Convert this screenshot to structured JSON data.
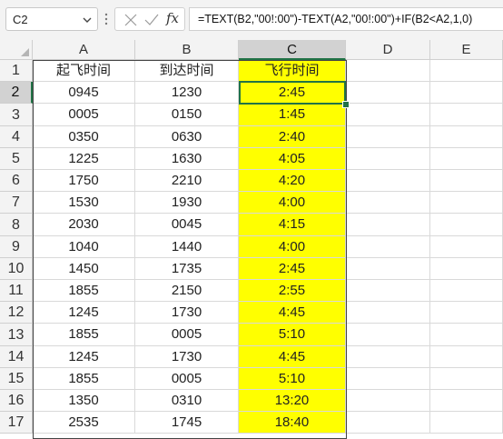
{
  "formula_bar": {
    "name_box": "C2",
    "fx_label": "fx",
    "formula": "=TEXT(B2,\"00!:00\")-TEXT(A2,\"00!:00\")+IF(B2<A2,1,0)"
  },
  "columns": [
    "A",
    "B",
    "C",
    "D",
    "E"
  ],
  "rows": [
    "1",
    "2",
    "3",
    "4",
    "5",
    "6",
    "7",
    "8",
    "9",
    "10",
    "11",
    "12",
    "13",
    "14",
    "15",
    "16",
    "17"
  ],
  "headers": {
    "a": "起飞时间",
    "b": "到达时间",
    "c": "飞行时间"
  },
  "data": [
    {
      "a": "0945",
      "b": "1230",
      "c": "2:45"
    },
    {
      "a": "0005",
      "b": "0150",
      "c": "1:45"
    },
    {
      "a": "0350",
      "b": "0630",
      "c": "2:40"
    },
    {
      "a": "1225",
      "b": "1630",
      "c": "4:05"
    },
    {
      "a": "1750",
      "b": "2210",
      "c": "4:20"
    },
    {
      "a": "1530",
      "b": "1930",
      "c": "4:00"
    },
    {
      "a": "2030",
      "b": "0045",
      "c": "4:15"
    },
    {
      "a": "1040",
      "b": "1440",
      "c": "4:00"
    },
    {
      "a": "1450",
      "b": "1735",
      "c": "2:45"
    },
    {
      "a": "1855",
      "b": "2150",
      "c": "2:55"
    },
    {
      "a": "1245",
      "b": "1730",
      "c": "4:45"
    },
    {
      "a": "1855",
      "b": "0005",
      "c": "5:10"
    },
    {
      "a": "1245",
      "b": "1730",
      "c": "4:45"
    },
    {
      "a": "1855",
      "b": "0005",
      "c": "5:10"
    },
    {
      "a": "1350",
      "b": "0310",
      "c": "13:20"
    },
    {
      "a": "2535",
      "b": "1745",
      "c": "18:40"
    }
  ],
  "selected_cell": "C2",
  "colors": {
    "highlight": "#ffff00",
    "selection": "#217346"
  }
}
